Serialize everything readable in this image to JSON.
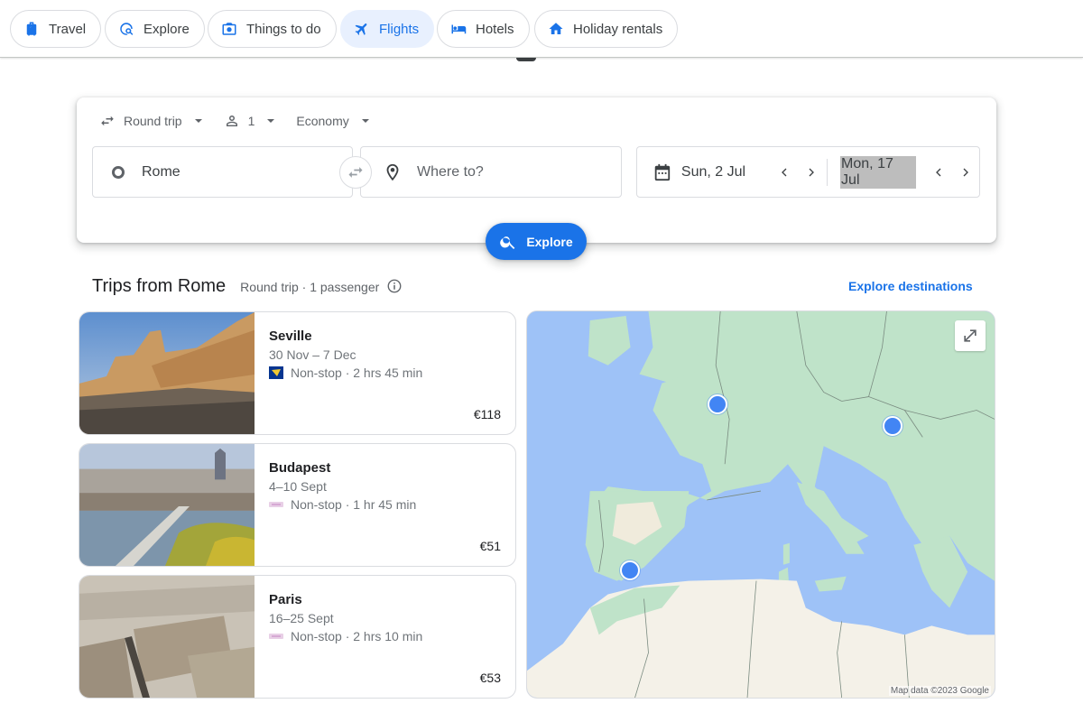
{
  "nav": {
    "tabs": [
      {
        "label": "Travel",
        "icon": "luggage-icon",
        "active": false
      },
      {
        "label": "Explore",
        "icon": "explore-icon",
        "active": false
      },
      {
        "label": "Things to do",
        "icon": "camera-icon",
        "active": false
      },
      {
        "label": "Flights",
        "icon": "airplane-icon",
        "active": true
      },
      {
        "label": "Hotels",
        "icon": "bed-icon",
        "active": false
      },
      {
        "label": "Holiday rentals",
        "icon": "house-icon",
        "active": false
      }
    ]
  },
  "search": {
    "trip_type": "Round trip",
    "passengers": "1",
    "cabin_class": "Economy",
    "origin": "Rome",
    "destination_placeholder": "Where to?",
    "depart_date": "Sun, 2 Jul",
    "return_date": "Mon, 17 Jul",
    "explore_label": "Explore"
  },
  "trips": {
    "title": "Trips from Rome",
    "subtitle": "Round trip · 1 passenger",
    "explore_link": "Explore destinations",
    "items": [
      {
        "city": "Seville",
        "dates": "30 Nov – 7 Dec",
        "flight": "Non-stop · 2 hrs 45 min",
        "price": "€118",
        "airline_icon": "ryanair-logo-icon"
      },
      {
        "city": "Budapest",
        "dates": "4–10 Sept",
        "flight": "Non-stop · 1 hr 45 min",
        "price": "€51",
        "airline_icon": "wizzair-logo-icon"
      },
      {
        "city": "Paris",
        "dates": "16–25 Sept",
        "flight": "Non-stop · 2 hrs 10 min",
        "price": "€53",
        "airline_icon": "wizzair-logo-icon"
      }
    ]
  },
  "map": {
    "attribution": "Map data ©2023 Google",
    "pins": [
      "Paris",
      "Budapest",
      "Seville"
    ]
  },
  "colors": {
    "accent": "#1a73e8",
    "active_tab_bg": "#e8f0fe",
    "map_water": "#9ec2f7",
    "map_land": "#bfe3c9",
    "pin": "#4285f4"
  }
}
